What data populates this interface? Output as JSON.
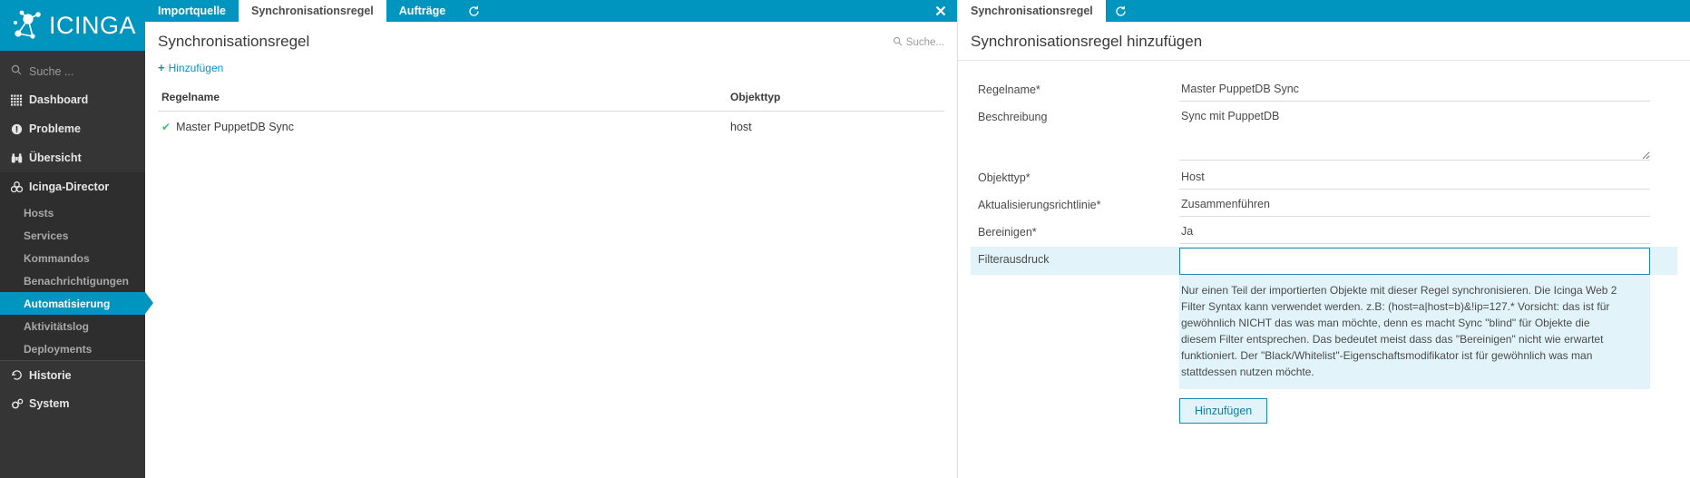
{
  "brand": {
    "name": "ICINGA",
    "accent": "#0095bf",
    "sidebar_bg": "#353535"
  },
  "sidebar": {
    "search_placeholder": "Suche ...",
    "items": [
      {
        "label": "Dashboard",
        "icon": "grid-icon",
        "level": "top",
        "state": "normal"
      },
      {
        "label": "Probleme",
        "icon": "warning-icon",
        "level": "top",
        "state": "normal"
      },
      {
        "label": "Übersicht",
        "icon": "binoculars-icon",
        "level": "top",
        "state": "normal"
      },
      {
        "label": "Icinga-Director",
        "icon": "director-icon",
        "level": "top",
        "state": "group-active"
      },
      {
        "label": "Hosts",
        "icon": "",
        "level": "sub",
        "state": "normal"
      },
      {
        "label": "Services",
        "icon": "",
        "level": "sub",
        "state": "normal"
      },
      {
        "label": "Kommandos",
        "icon": "",
        "level": "sub",
        "state": "normal"
      },
      {
        "label": "Benachrichtigungen",
        "icon": "",
        "level": "sub",
        "state": "normal"
      },
      {
        "label": "Automatisierung",
        "icon": "",
        "level": "sub",
        "state": "selected"
      },
      {
        "label": "Aktivitätslog",
        "icon": "",
        "level": "sub",
        "state": "normal"
      },
      {
        "label": "Deployments",
        "icon": "",
        "level": "sub",
        "state": "normal"
      },
      {
        "label": "Historie",
        "icon": "history-icon",
        "level": "top",
        "state": "normal"
      },
      {
        "label": "System",
        "icon": "gears-icon",
        "level": "top",
        "state": "normal"
      }
    ]
  },
  "left_pane": {
    "tabs": [
      {
        "label": "Importquelle",
        "active": false
      },
      {
        "label": "Synchronisationsregel",
        "active": true
      },
      {
        "label": "Aufträge",
        "active": false
      }
    ],
    "refresh_icon": "refresh-icon",
    "close_icon": "close-icon",
    "title": "Synchronisationsregel",
    "search_placeholder": "Suche...",
    "add_label": "Hinzufügen",
    "table": {
      "columns": [
        "Regelname",
        "Objekttyp"
      ],
      "rows": [
        {
          "status_icon": "check-icon",
          "name": "Master PuppetDB Sync",
          "type": "host"
        }
      ]
    }
  },
  "right_pane": {
    "tabs": [
      {
        "label": "Synchronisationsregel",
        "active": true
      }
    ],
    "refresh_icon": "refresh-icon",
    "title": "Synchronisationsregel hinzufügen",
    "fields": [
      {
        "label": "Regelname*",
        "value": "Master PuppetDB Sync",
        "kind": "input"
      },
      {
        "label": "Beschreibung",
        "value": "Sync mit PuppetDB",
        "kind": "textarea"
      },
      {
        "label": "Objekttyp*",
        "value": "Host",
        "kind": "input"
      },
      {
        "label": "Aktualisierungsrichtlinie*",
        "value": "Zusammenführen",
        "kind": "input"
      },
      {
        "label": "Bereinigen*",
        "value": "Ja",
        "kind": "input"
      }
    ],
    "filter_field": {
      "label": "Filterausdruck",
      "value": "",
      "focused": true,
      "help": "Nur einen Teil der importierten Objekte mit dieser Regel synchronisieren. Die Icinga Web 2 Filter Syntax kann verwendet werden. z.B: (host=a|host=b)&!ip=127.* Vorsicht: das ist für gewöhnlich NICHT das was man möchte, denn es macht Sync \"blind\" für Objekte die diesem Filter entsprechen. Das bedeutet meist dass das \"Bereinigen\" nicht wie erwartet funktioniert. Der \"Black/Whitelist\"-Eigenschaftsmodifikator ist für gewöhnlich was man stattdessen nutzen möchte."
    },
    "submit_label": "Hinzufügen"
  }
}
